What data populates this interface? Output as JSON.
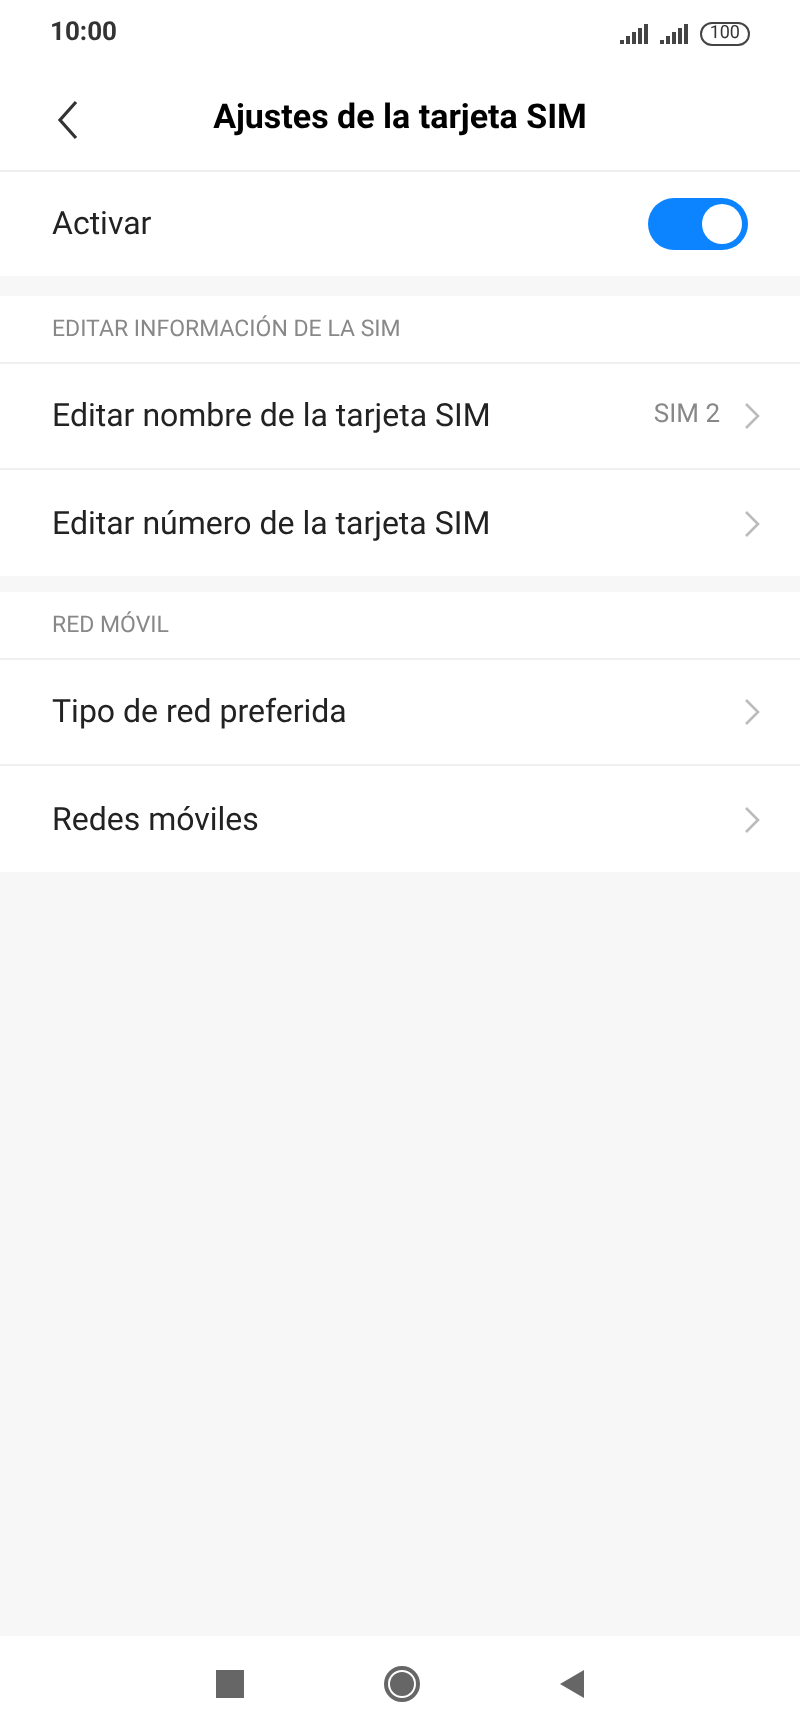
{
  "status_bar": {
    "time": "10:00",
    "battery": "100"
  },
  "header": {
    "title": "Ajustes de la tarjeta SIM"
  },
  "toggle": {
    "label": "Activar",
    "on": true
  },
  "sections": [
    {
      "title": "EDITAR INFORMACIÓN DE LA SIM",
      "items": [
        {
          "label": "Editar nombre de la tarjeta SIM",
          "value": "SIM 2"
        },
        {
          "label": "Editar número de la tarjeta SIM"
        }
      ]
    },
    {
      "title": "RED MÓVIL",
      "items": [
        {
          "label": "Tipo de red preferida"
        },
        {
          "label": "Redes móviles"
        }
      ]
    }
  ]
}
